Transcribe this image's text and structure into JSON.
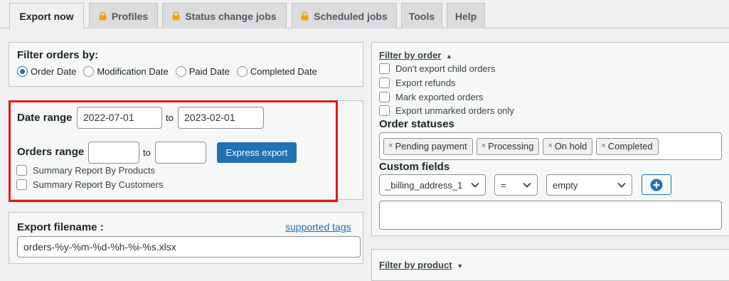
{
  "tabs": [
    {
      "label": "Export now",
      "active": true,
      "locked": false
    },
    {
      "label": "Profiles",
      "active": false,
      "locked": true
    },
    {
      "label": "Status change jobs",
      "active": false,
      "locked": true
    },
    {
      "label": "Scheduled jobs",
      "active": false,
      "locked": true
    },
    {
      "label": "Tools",
      "active": false,
      "locked": false
    },
    {
      "label": "Help",
      "active": false,
      "locked": false
    }
  ],
  "filter": {
    "title": "Filter orders by:",
    "options": [
      "Order Date",
      "Modification Date",
      "Paid Date",
      "Completed Date"
    ],
    "selected": "Order Date"
  },
  "range": {
    "date_label": "Date range",
    "date_from": "2022-07-01",
    "date_to": "2023-02-01",
    "to": "to",
    "orders_label": "Orders range",
    "orders_from": "",
    "orders_to": "",
    "express_button": "Express export",
    "summary_products": "Summary Report By Products",
    "summary_customers": "Summary Report By Customers"
  },
  "filename": {
    "label": "Export filename :",
    "tags_link": "supported tags",
    "value": "orders-%y-%m-%d-%h-%i-%s.xlsx"
  },
  "order_filter": {
    "title": "Filter by order",
    "arrow": "▲",
    "checkboxes": [
      "Don't export child orders",
      "Export refunds",
      "Mark exported orders",
      "Export unmarked orders only"
    ],
    "statuses_label": "Order statuses",
    "statuses": [
      "Pending payment",
      "Processing",
      "On hold",
      "Completed"
    ],
    "custom_fields_label": "Custom fields",
    "field": "_billing_address_1",
    "operator": "=",
    "value": "empty"
  },
  "product_filter": {
    "title": "Filter by product",
    "arrow": "▼"
  },
  "colors": {
    "accent": "#2271b1",
    "highlight": "#e2191b",
    "lock": "#f0a30a"
  }
}
